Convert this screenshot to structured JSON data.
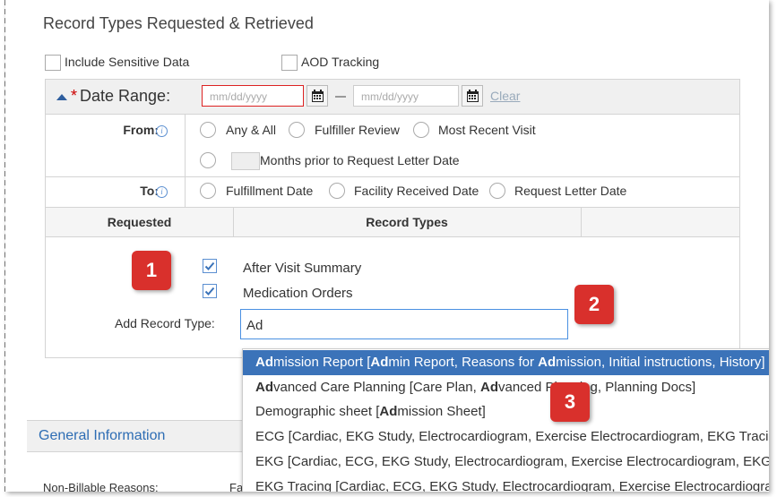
{
  "section_title": "Record Types Requested & Retrieved",
  "options": {
    "include_sensitive_label": "Include Sensitive Data",
    "aod_tracking_label": "AOD Tracking"
  },
  "date_range": {
    "label": "Date Range:",
    "required_mark": "*",
    "start_placeholder": "mm/dd/yyyy",
    "end_placeholder": "mm/dd/yyyy",
    "clear_label": "Clear"
  },
  "from": {
    "label": "From:",
    "info_icon": "ⓘ",
    "options": [
      "Any & All",
      "Fulfiller Review",
      "Most Recent Visit"
    ],
    "months_label": "Months prior to Request Letter Date"
  },
  "to": {
    "label": "To:",
    "info_icon": "ⓘ",
    "options": [
      "Fulfillment Date",
      "Facility Received Date",
      "Request Letter Date"
    ]
  },
  "table": {
    "headers": [
      "Requested",
      "Record Types"
    ],
    "record_types": [
      "After Visit Summary",
      "Medication Orders"
    ],
    "add_label": "Add Record Type:",
    "add_value": "Ad"
  },
  "badges": [
    "1",
    "2",
    "3"
  ],
  "dropdown": {
    "items": [
      {
        "bold": "Ad",
        "rest": "mission Report [",
        "bold2": "Ad",
        "rest2": "min Report, Reasons for ",
        "bold3": "Ad",
        "rest3": "mission, Initial instructions, History]"
      },
      {
        "bold": "Ad",
        "rest": "vanced Care Planning [Care Plan, ",
        "bold2": "Ad",
        "rest2": "vanced Planning, Planning Docs]",
        "bold3": "",
        "rest3": ""
      },
      {
        "bold": "",
        "rest": "Demographic sheet [",
        "bold2": "Ad",
        "rest2": "mission Sheet]",
        "bold3": "",
        "rest3": ""
      },
      {
        "bold": "",
        "rest": "ECG [Cardiac, EKG Study, Electrocardiogram, Exercise Electrocardiogram, EKG Tracing]",
        "bold2": "",
        "rest2": "",
        "bold3": "",
        "rest3": ""
      },
      {
        "bold": "",
        "rest": "EKG [Cardiac, ECG, EKG Study, Electrocardiogram, Exercise Electrocardiogram, EKG Tracing]",
        "bold2": "",
        "rest2": "",
        "bold3": "",
        "rest3": ""
      },
      {
        "bold": "",
        "rest": "EKG Tracing [Cardiac, ECG, EKG Study, Electrocardiogram, Exercise Electrocardiogram]",
        "bold2": "",
        "rest2": "",
        "bold3": "",
        "rest3": ""
      }
    ],
    "selected_index": 0
  },
  "general_info": {
    "title": "General Information",
    "non_billable_label": "Non-Billable Reasons:",
    "non_billable_value": "Fa"
  }
}
